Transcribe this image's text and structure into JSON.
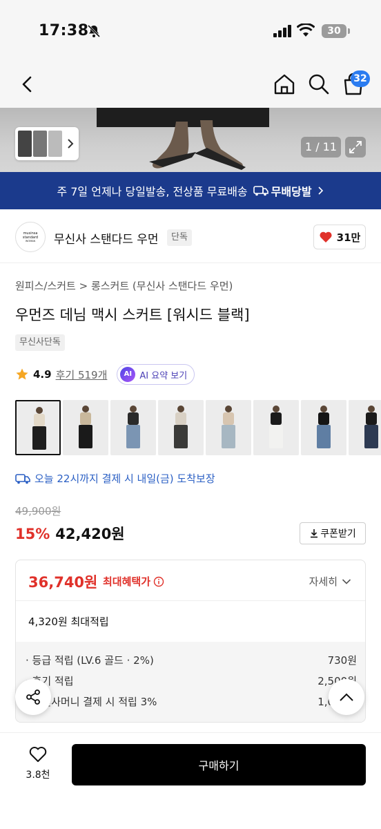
{
  "status_bar": {
    "time": "17:38",
    "battery": "30"
  },
  "nav": {
    "cart_count": "32"
  },
  "hero": {
    "counter": "1 / 11"
  },
  "promo": {
    "text": "주 7일 언제나 당일발송, 전상품 무료배송",
    "badge": "무배당발"
  },
  "brand": {
    "logo_line1": "musinsa",
    "logo_line2": "standard",
    "logo_line3": "WOMAN",
    "name": "무신사 스탠다드 우먼",
    "tag": "단독",
    "likes": "31만"
  },
  "product": {
    "breadcrumb": "원피스/스커트 > 롱스커트 (무신사 스탠다드 우먼)",
    "title": "우먼즈 데님 맥시 스커트 [워시드 블랙]",
    "tag": "무신사단독",
    "rating": "4.9",
    "reviews": "후기 519개",
    "ai_label": "AI 요약 보기",
    "delivery": "오늘 22시까지 결제 시 내일(금) 도착보장"
  },
  "thumbnails": [
    {
      "top": "#e3d9c8",
      "skirt": "#1e1e1e"
    },
    {
      "top": "#c9b89c",
      "skirt": "#1a1a1a"
    },
    {
      "top": "#2a2a2a",
      "skirt": "#7b95b3"
    },
    {
      "top": "#d8d0c4",
      "skirt": "#3a3a38"
    },
    {
      "top": "#d7c5b0",
      "skirt": "#a7b7c2"
    },
    {
      "top": "#1b1b1b",
      "skirt": "#f2f2f0"
    },
    {
      "top": "#151515",
      "skirt": "#5f7ea3"
    },
    {
      "top": "#1a1a1a",
      "skirt": "#2d3a52"
    }
  ],
  "pricing": {
    "original": "49,900원",
    "discount": "15%",
    "price": "42,420원",
    "coupon": "쿠폰받기"
  },
  "benefits": {
    "max_price": "36,740원",
    "max_label": "최대혜택가",
    "detail": "자세히",
    "max_points": "4,320원 최대적립",
    "rows": [
      {
        "label": "· 등급 적립 (LV.6 골드 · 2%)",
        "value": "730원"
      },
      {
        "label": "· 후기 적립",
        "value": "2,500원"
      },
      {
        "label": "· 무신사머니 결제 시 적립 3%",
        "value": "1,090원"
      }
    ]
  },
  "bottom": {
    "wish_count": "3.8천",
    "buy": "구매하기"
  },
  "colors": {
    "accent_red": "#e0312a",
    "promo_blue": "#1b3a8c",
    "badge_blue": "#2b7cf0",
    "link_blue": "#2a5fc4"
  }
}
